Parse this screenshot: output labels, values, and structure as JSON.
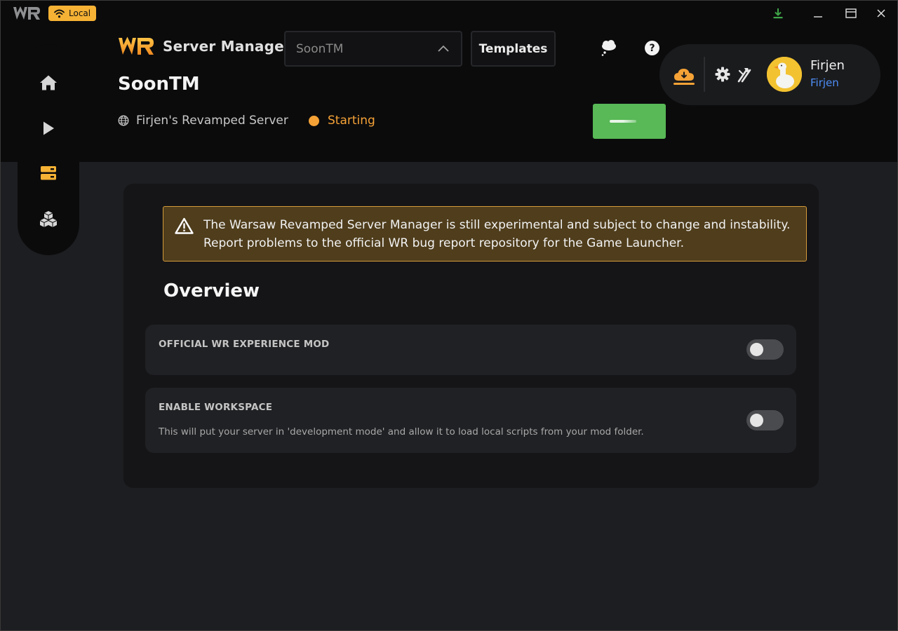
{
  "titlebar": {
    "badge_label": "Local"
  },
  "header": {
    "brand": "Server Manager",
    "server_select": {
      "value": "SoonTM"
    },
    "templates_label": "Templates",
    "page_title": "SoonTM",
    "server_name": "Firjen's Revamped Server",
    "status": "Starting"
  },
  "user": {
    "name": "Firjen",
    "sub": "Firjen"
  },
  "main": {
    "warning": {
      "line1": "The Warsaw Revamped Server Manager is still experimental and subject to change and instability.",
      "line2": "Report problems to the official WR bug report repository for the Game Launcher."
    },
    "section_title": "Overview",
    "settings": [
      {
        "label": "OFFICIAL WR EXPERIENCE MOD",
        "description": "",
        "enabled": false
      },
      {
        "label": "ENABLE WORKSPACE",
        "description": "This will put your server in 'development mode' and allow it to load local scripts from your mod folder.",
        "enabled": false
      }
    ]
  },
  "colors": {
    "accent": "#f5a236",
    "success": "#58b956",
    "link": "#4d8df5",
    "warning_bg": "#4f3d1c"
  }
}
